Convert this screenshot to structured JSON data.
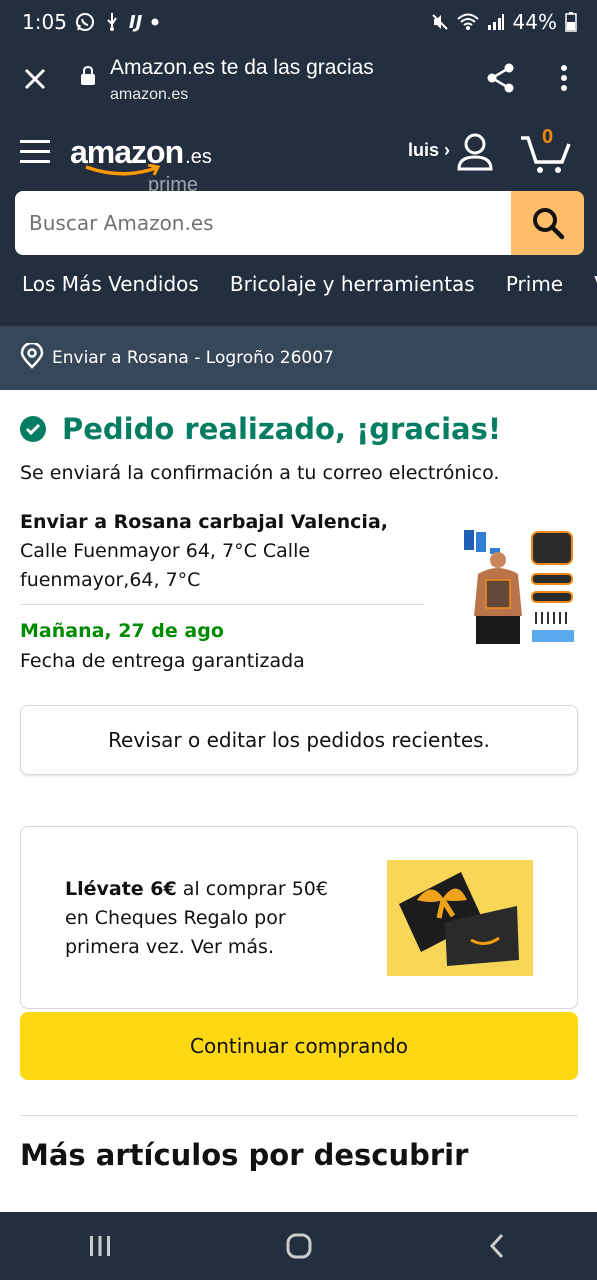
{
  "status_bar": {
    "time": "1:05",
    "battery": "44%",
    "notification_icons": [
      "whatsapp-icon",
      "usb-icon",
      "ij-icon",
      "dot-icon"
    ],
    "right_icons": [
      "mute-icon",
      "wifi-icon",
      "signal-icon",
      "battery-icon"
    ]
  },
  "browser": {
    "title": "Amazon.es te da las gracias",
    "url": "amazon.es"
  },
  "header": {
    "logo_word": "amazon",
    "logo_suffix": ".es",
    "logo_sub": "prime",
    "user_label": "luis ›",
    "cart_count": "0"
  },
  "search": {
    "placeholder": "Buscar Amazon.es"
  },
  "nav_links": [
    "Los Más Vendidos",
    "Bricolaje y herramientas",
    "Prime",
    "Vo"
  ],
  "delivery": {
    "label": "Enviar a Rosana - Logroño 26007"
  },
  "order": {
    "title": "Pedido realizado, ¡gracias!",
    "confirmation_text": "Se enviará la confirmación a tu correo electrónico.",
    "ship_to_name": "Enviar a Rosana carbajal Valencia,",
    "ship_to_address": "Calle Fuenmayor 64, 7°C Calle fuenmayor,64, 7°C",
    "delivery_date": "Mañana, 27 de ago",
    "delivery_note": "Fecha de entrega garantizada"
  },
  "actions": {
    "review_label": "Revisar o editar los pedidos recientes.",
    "continue_label": "Continuar comprando"
  },
  "promo": {
    "bold": "Llévate 6€",
    "text": " al comprar 50€ en Cheques Regalo por primera vez. Ver más."
  },
  "section": {
    "more_title": "Más artículos por descubrir"
  },
  "colors": {
    "header_bg": "#232f3e",
    "delivery_bg": "#37475a",
    "success_green": "#067d62",
    "date_green": "#008a00",
    "search_button": "#febd69",
    "continue_button": "#ffd814",
    "cart_orange": "#f08804"
  }
}
